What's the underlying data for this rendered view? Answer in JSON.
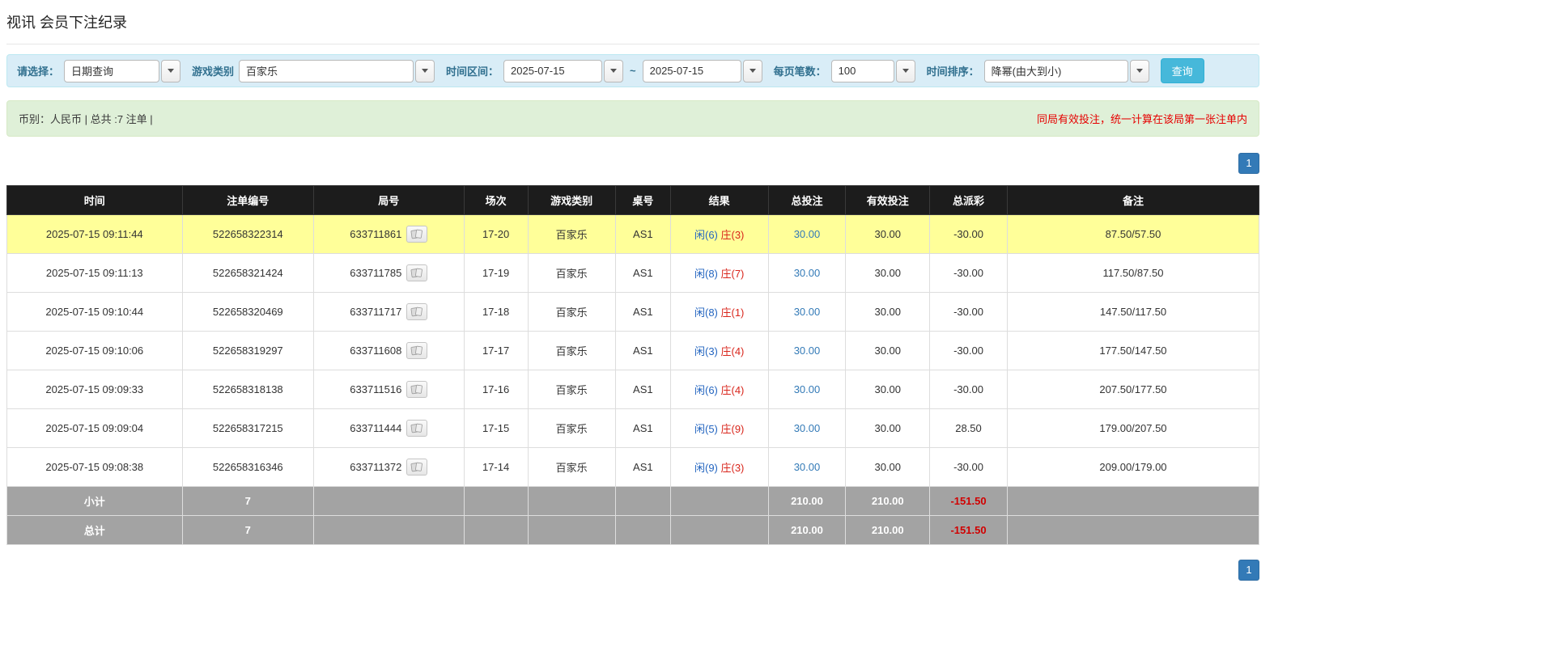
{
  "page": {
    "title": "视讯 会员下注纪录"
  },
  "filters": {
    "select_label": "请选择：",
    "select_value": "日期查询",
    "game_type_label": "游戏类别",
    "game_type_value": "百家乐",
    "date_range_label": "时间区间：",
    "date_from": "2025-07-15",
    "date_separator": "~",
    "date_to": "2025-07-15",
    "page_size_label": "每页笔数：",
    "page_size_value": "100",
    "sort_label": "时间排序：",
    "sort_value": "降幂(由大到小)",
    "search_button": "查询"
  },
  "summary": {
    "left": "币别：人民币 | 总共 :7 注单 |",
    "right_notice": "同局有效投注，统一计算在该局第一张注单内"
  },
  "pagination": {
    "page": "1"
  },
  "colors": {
    "accent_blue": "#337ab7",
    "negative_red": "#d10000",
    "player_blue": "#2365c0",
    "banker_red": "#d9261c",
    "highlight_yellow": "#ffff99"
  },
  "icons": {
    "round_icon": "cards-replay-icon",
    "dropdown": "chevron-down-icon"
  },
  "table": {
    "headers": [
      "时间",
      "注单编号",
      "局号",
      "场次",
      "游戏类别",
      "桌号",
      "结果",
      "总投注",
      "有效投注",
      "总派彩",
      "备注"
    ],
    "rows": [
      {
        "time": "2025-07-15 09:11:44",
        "bet_id": "522658322314",
        "round_id": "633711861",
        "session": "17-20",
        "game": "百家乐",
        "table_no": "AS1",
        "result_player": "闲(6)",
        "result_banker": "庄(3)",
        "total_bet": "30.00",
        "valid_bet": "30.00",
        "payout": "-30.00",
        "note": "87.50/57.50",
        "highlight": true
      },
      {
        "time": "2025-07-15 09:11:13",
        "bet_id": "522658321424",
        "round_id": "633711785",
        "session": "17-19",
        "game": "百家乐",
        "table_no": "AS1",
        "result_player": "闲(8)",
        "result_banker": "庄(7)",
        "total_bet": "30.00",
        "valid_bet": "30.00",
        "payout": "-30.00",
        "note": "117.50/87.50",
        "highlight": false
      },
      {
        "time": "2025-07-15 09:10:44",
        "bet_id": "522658320469",
        "round_id": "633711717",
        "session": "17-18",
        "game": "百家乐",
        "table_no": "AS1",
        "result_player": "闲(8)",
        "result_banker": "庄(1)",
        "total_bet": "30.00",
        "valid_bet": "30.00",
        "payout": "-30.00",
        "note": "147.50/117.50",
        "highlight": false
      },
      {
        "time": "2025-07-15 09:10:06",
        "bet_id": "522658319297",
        "round_id": "633711608",
        "session": "17-17",
        "game": "百家乐",
        "table_no": "AS1",
        "result_player": "闲(3)",
        "result_banker": "庄(4)",
        "total_bet": "30.00",
        "valid_bet": "30.00",
        "payout": "-30.00",
        "note": "177.50/147.50",
        "highlight": false
      },
      {
        "time": "2025-07-15 09:09:33",
        "bet_id": "522658318138",
        "round_id": "633711516",
        "session": "17-16",
        "game": "百家乐",
        "table_no": "AS1",
        "result_player": "闲(6)",
        "result_banker": "庄(4)",
        "total_bet": "30.00",
        "valid_bet": "30.00",
        "payout": "-30.00",
        "note": "207.50/177.50",
        "highlight": false
      },
      {
        "time": "2025-07-15 09:09:04",
        "bet_id": "522658317215",
        "round_id": "633711444",
        "session": "17-15",
        "game": "百家乐",
        "table_no": "AS1",
        "result_player": "闲(5)",
        "result_banker": "庄(9)",
        "total_bet": "30.00",
        "valid_bet": "30.00",
        "payout": "28.50",
        "note": "179.00/207.50",
        "highlight": false
      },
      {
        "time": "2025-07-15 09:08:38",
        "bet_id": "522658316346",
        "round_id": "633711372",
        "session": "17-14",
        "game": "百家乐",
        "table_no": "AS1",
        "result_player": "闲(9)",
        "result_banker": "庄(3)",
        "total_bet": "30.00",
        "valid_bet": "30.00",
        "payout": "-30.00",
        "note": "209.00/179.00",
        "highlight": false
      }
    ],
    "subtotal": {
      "label": "小计",
      "count": "7",
      "total_bet": "210.00",
      "valid_bet": "210.00",
      "payout": "-151.50"
    },
    "total": {
      "label": "总计",
      "count": "7",
      "total_bet": "210.00",
      "valid_bet": "210.00",
      "payout": "-151.50"
    }
  }
}
